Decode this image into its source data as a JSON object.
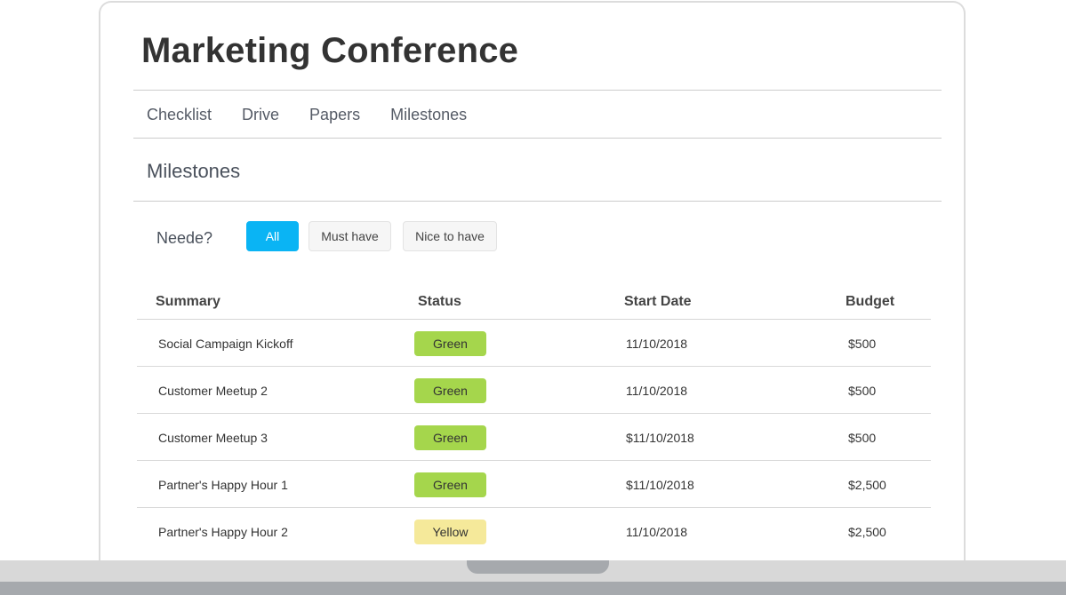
{
  "header": {
    "title": "Marketing Conference"
  },
  "nav": {
    "tabs": [
      {
        "label": "Checklist"
      },
      {
        "label": "Drive"
      },
      {
        "label": "Papers"
      },
      {
        "label": "Milestones"
      }
    ]
  },
  "section": {
    "title": "Milestones"
  },
  "filter": {
    "label": "Neede?",
    "options": [
      {
        "label": "All",
        "selected": true
      },
      {
        "label": "Must have",
        "selected": false
      },
      {
        "label": "Nice to have",
        "selected": false
      }
    ]
  },
  "table": {
    "columns": [
      "Summary",
      "Status",
      "Start Date",
      "Budget"
    ],
    "rows": [
      {
        "summary": "Social Campaign Kickoff",
        "status": "Green",
        "start_date": "11/10/2018",
        "budget": "$500"
      },
      {
        "summary": "Customer Meetup 2",
        "status": "Green",
        "start_date": "11/10/2018",
        "budget": "$500"
      },
      {
        "summary": "Customer Meetup 3",
        "status": "Green",
        "start_date": "$11/10/2018",
        "budget": "$500"
      },
      {
        "summary": "Partner's Happy Hour 1",
        "status": "Green",
        "start_date": "$11/10/2018",
        "budget": "$2,500"
      },
      {
        "summary": "Partner's Happy Hour 2",
        "status": "Yellow",
        "start_date": "11/10/2018",
        "budget": "$2,500"
      }
    ]
  },
  "colors": {
    "accent": "#0ab4f4",
    "status_green": "#a5d64c",
    "status_yellow": "#f5e99a",
    "laptop_body": "#d8d8d8",
    "laptop_trim": "#a6a9ad"
  }
}
